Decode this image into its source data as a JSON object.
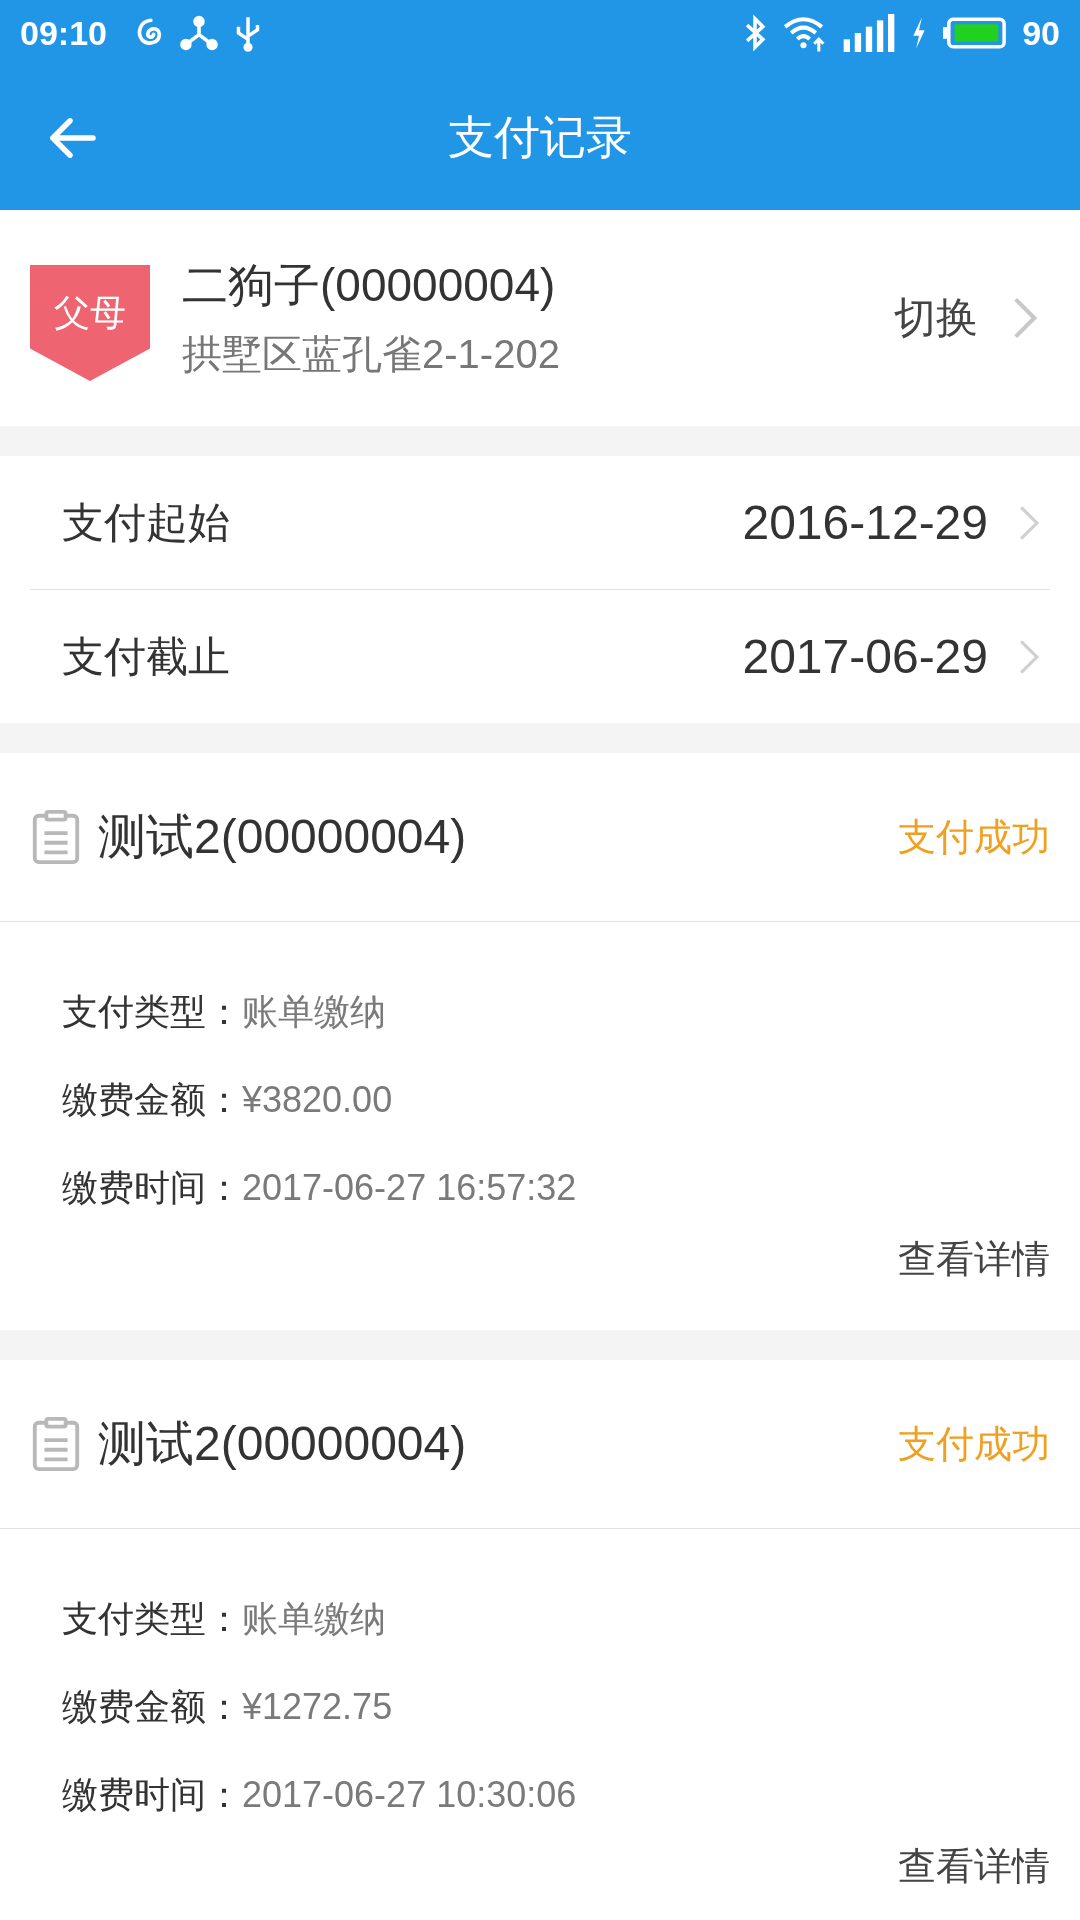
{
  "status_bar": {
    "time": "09:10",
    "battery": "90"
  },
  "header": {
    "title": "支付记录"
  },
  "profile": {
    "badge": "父母",
    "name": "二狗子(00000004)",
    "address": "拱墅区蓝孔雀2-1-202",
    "action": "切换"
  },
  "date_range": [
    {
      "label": "支付起始",
      "value": "2016-12-29"
    },
    {
      "label": "支付截止",
      "value": "2017-06-29"
    }
  ],
  "records": [
    {
      "title": "测试2(00000004)",
      "status": "支付成功",
      "fields": [
        {
          "label": "支付类型：",
          "value": "账单缴纳"
        },
        {
          "label": "缴费金额：",
          "value": "¥3820.00"
        },
        {
          "label": "缴费时间：",
          "value": "2017-06-27 16:57:32"
        }
      ],
      "link": "查看详情"
    },
    {
      "title": "测试2(00000004)",
      "status": "支付成功",
      "fields": [
        {
          "label": "支付类型：",
          "value": "账单缴纳"
        },
        {
          "label": "缴费金额：",
          "value": "¥1272.75"
        },
        {
          "label": "缴费时间：",
          "value": "2017-06-27 10:30:06"
        }
      ],
      "link": "查看详情"
    }
  ]
}
